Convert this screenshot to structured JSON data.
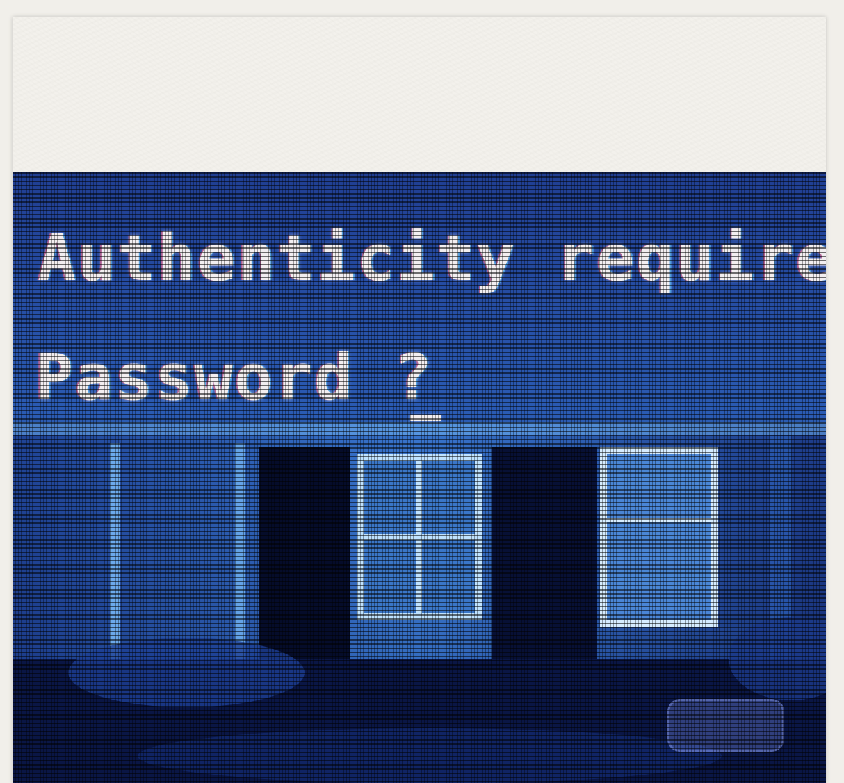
{
  "screen": {
    "line1": "Authenticity required.",
    "line2": "Password ?"
  },
  "colors": {
    "paper": "#f3f1ec",
    "screen_bg": "#0b1a4a",
    "text": "#f2eef0",
    "glow": "#5a9cff"
  }
}
